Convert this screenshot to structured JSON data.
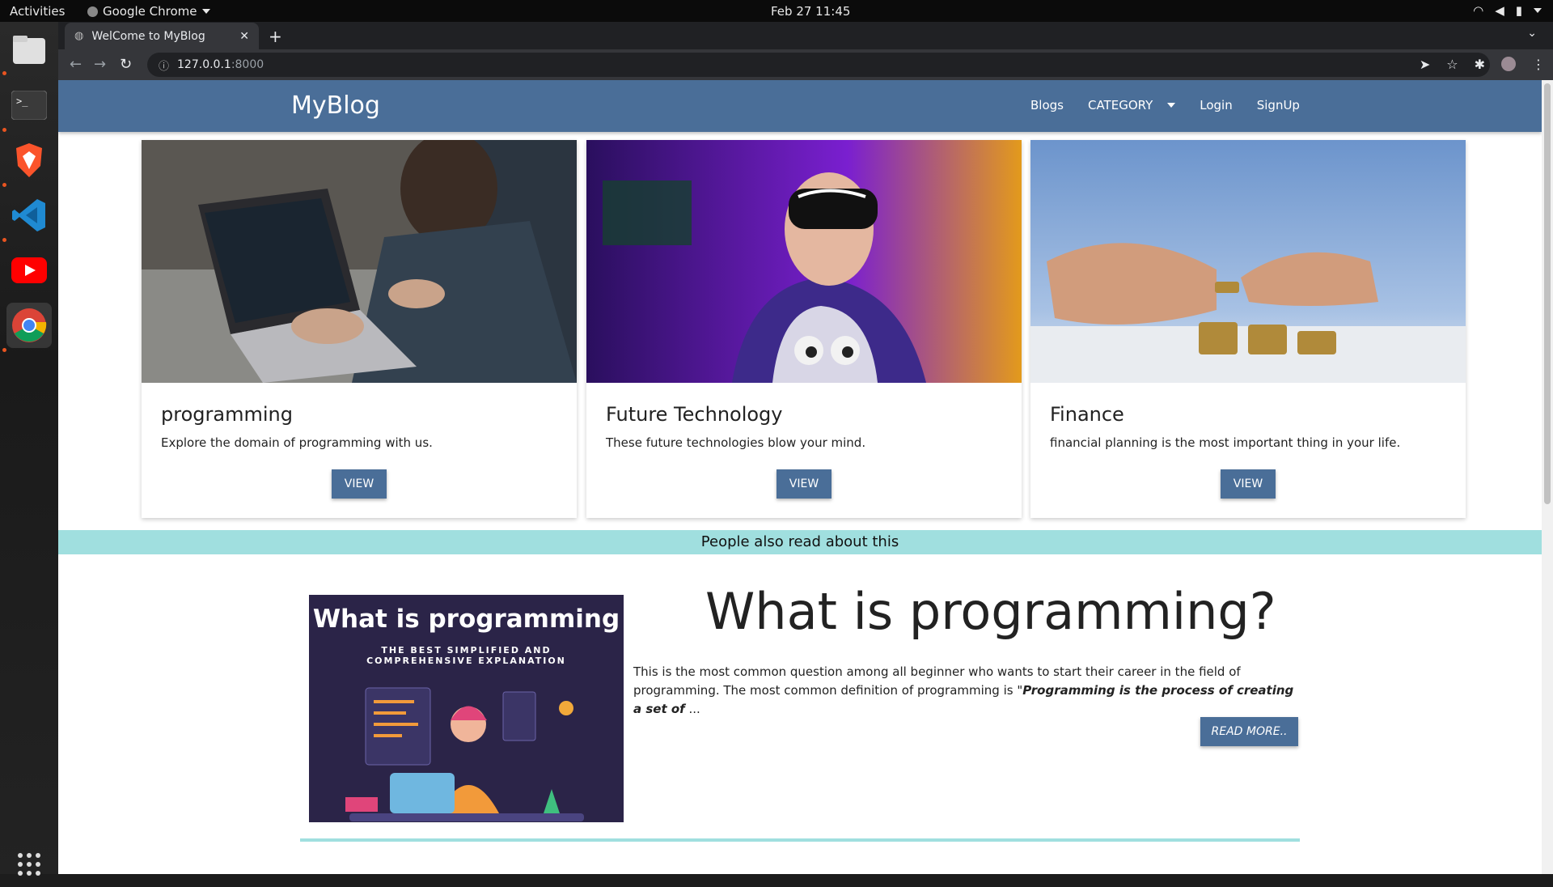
{
  "system": {
    "activities": "Activities",
    "app_name": "Google Chrome",
    "clock": "Feb 27  11:45"
  },
  "browser": {
    "tab_title": "WelCome to MyBlog",
    "url_host": "127.0.0.1",
    "url_port": ":8000"
  },
  "site": {
    "brand": "MyBlog",
    "nav": {
      "blogs": "Blogs",
      "category": "CATEGORY",
      "login": "Login",
      "signup": "SignUp"
    },
    "cards": [
      {
        "title": "programming",
        "desc": "Explore the domain of programming with us.",
        "button": "VIEW"
      },
      {
        "title": "Future Technology",
        "desc": "These future technologies blow your mind.",
        "button": "VIEW"
      },
      {
        "title": "Finance",
        "desc": "financial planning is the most important thing in your life.",
        "button": "VIEW"
      }
    ],
    "band_text": "People also read about this",
    "post": {
      "image_heading": "What is programming",
      "image_subheading": "THE BEST SIMPLIFIED AND COMPREHENSIVE EXPLANATION",
      "title": "What is programming?",
      "text": "This is the most common question among all beginner who wants to start their career in the field of programming. The most common definition of programming is \"",
      "text_bold": "Programming is the process of creating a set of",
      "text_end": " ...",
      "button": "READ MORE.."
    }
  },
  "colors": {
    "navbar": "#4a6e98",
    "band": "#a0dfdf",
    "post_image_bg": "#2b2448"
  }
}
